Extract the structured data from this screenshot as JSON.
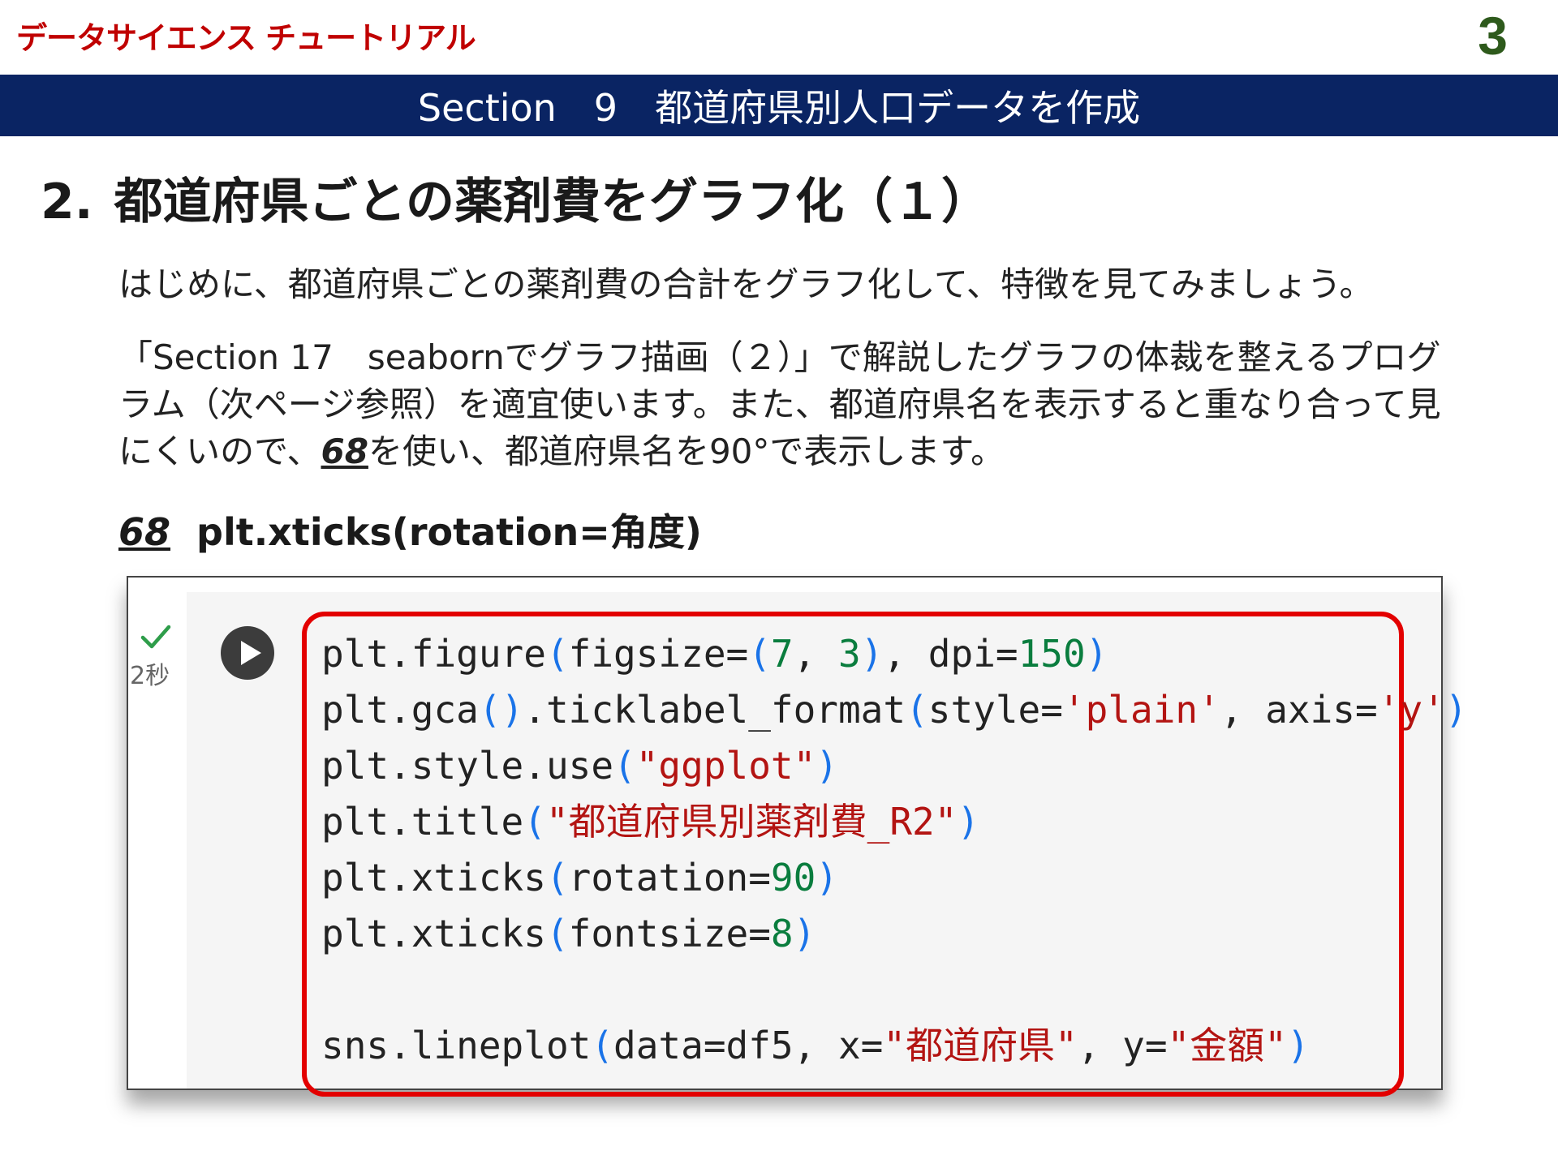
{
  "header": {
    "brand": "データサイエンス チュートリアル",
    "page_number": "3"
  },
  "section": {
    "title": "Section　9　都道府県別人口データを作成"
  },
  "heading": {
    "number": "2.",
    "text": "都道府県ごとの薬剤費をグラフ化（１）"
  },
  "body": {
    "p1": "はじめに、都道府県ごとの薬剤費の合計をグラフ化して、特徴を見てみましょう。",
    "p2_before": "「Section 17　seabornでグラフ描画（２）」で解説したグラフの体裁を整えるプログラム（次ページ参照）を適宜使います。また、都道府県名を表示すると重なり合って見にくいので、",
    "p2_ref": "68",
    "p2_after": "を使い、都道府県名を90°で表示します。"
  },
  "function_ref": {
    "number": "68",
    "signature": "plt.xticks(rotation=角度)"
  },
  "cell": {
    "exec_time": "2秒",
    "status_icon": "check-icon",
    "run_icon": "play-icon",
    "code_lines": [
      [
        [
          "plt.figure",
          "p"
        ],
        [
          "(",
          "b"
        ],
        [
          "figsize=",
          "p"
        ],
        [
          "(",
          "b"
        ],
        [
          "7",
          "n"
        ],
        [
          ", ",
          "p"
        ],
        [
          "3",
          "n"
        ],
        [
          ")",
          "b"
        ],
        [
          ", dpi=",
          "p"
        ],
        [
          "150",
          "n"
        ],
        [
          ")",
          "b"
        ]
      ],
      [
        [
          "plt.gca",
          "p"
        ],
        [
          "()",
          "b"
        ],
        [
          ".ticklabel_format",
          "p"
        ],
        [
          "(",
          "b"
        ],
        [
          "style=",
          "p"
        ],
        [
          "'plain'",
          "s"
        ],
        [
          ", axis=",
          "p"
        ],
        [
          "'y'",
          "s"
        ],
        [
          ")",
          "b"
        ]
      ],
      [
        [
          "plt.style.use",
          "p"
        ],
        [
          "(",
          "b"
        ],
        [
          "\"ggplot\"",
          "s"
        ],
        [
          ")",
          "b"
        ]
      ],
      [
        [
          "plt.title",
          "p"
        ],
        [
          "(",
          "b"
        ],
        [
          "\"都道府県別薬剤費_R2\"",
          "s"
        ],
        [
          ")",
          "b"
        ]
      ],
      [
        [
          "plt.xticks",
          "p"
        ],
        [
          "(",
          "b"
        ],
        [
          "rotation=",
          "p"
        ],
        [
          "90",
          "n"
        ],
        [
          ")",
          "b"
        ]
      ],
      [
        [
          "plt.xticks",
          "p"
        ],
        [
          "(",
          "b"
        ],
        [
          "fontsize=",
          "p"
        ],
        [
          "8",
          "n"
        ],
        [
          ")",
          "b"
        ]
      ],
      [],
      [
        [
          "sns.lineplot",
          "p"
        ],
        [
          "(",
          "b"
        ],
        [
          "data=df5, x=",
          "p"
        ],
        [
          "\"都道府県\"",
          "s"
        ],
        [
          ", y=",
          "p"
        ],
        [
          "\"金額\"",
          "s"
        ],
        [
          ")",
          "b"
        ]
      ]
    ]
  },
  "colors": {
    "section_bar": "#0a2463",
    "brand": "#c00000",
    "page_number": "#2e5a1c",
    "highlight_border": "#e30000"
  }
}
